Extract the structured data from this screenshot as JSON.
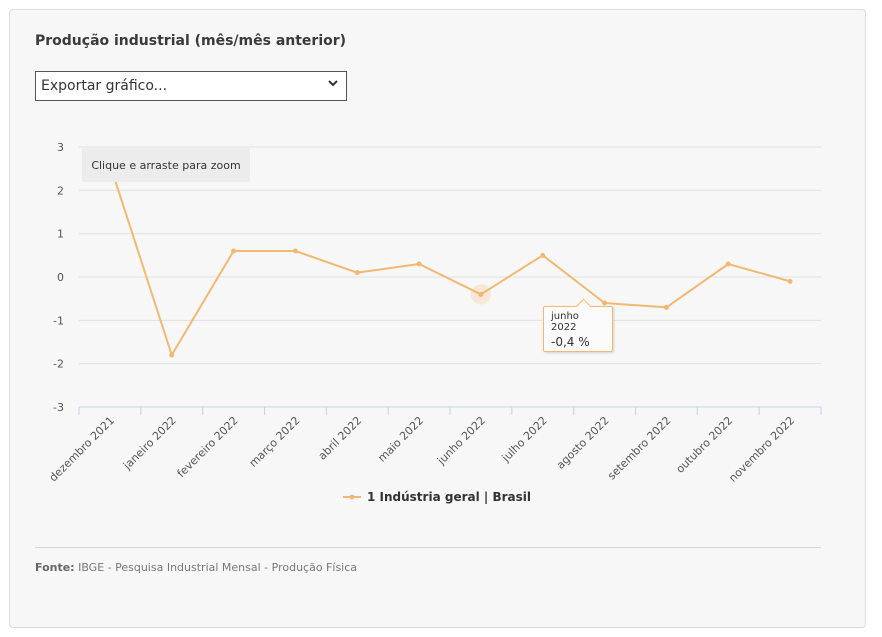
{
  "title": "Produção industrial (mês/mês anterior)",
  "export_select": {
    "selected": "Exportar gráfico...",
    "icon": "chevron-down-icon"
  },
  "zoom_hint": "Clique e arraste para zoom",
  "tooltip": {
    "date": "junho 2022",
    "value": "-0,4 %"
  },
  "legend": {
    "label": "1 Indústria geral | Brasil"
  },
  "source": {
    "label": "Fonte:",
    "text": "IBGE - Pesquisa Industrial Mensal - Produção Física"
  },
  "colors": {
    "series": "#f2b872",
    "grid": "#e2e2e2",
    "axis": "#c6d0e8",
    "card_bg": "#f7f7f7"
  },
  "chart_data": {
    "type": "line",
    "title": "Produção industrial (mês/mês anterior)",
    "xlabel": "",
    "ylabel": "",
    "categories": [
      "dezembro 2021",
      "janeiro 2022",
      "fevereiro 2022",
      "março 2022",
      "abril 2022",
      "maio 2022",
      "junho 2022",
      "julho 2022",
      "agosto 2022",
      "setembro 2022",
      "outubro 2022",
      "novembro 2022"
    ],
    "series": [
      {
        "name": "1 Indústria geral | Brasil",
        "values": [
          2.6,
          -1.8,
          0.6,
          0.6,
          0.1,
          0.3,
          -0.4,
          0.5,
          -0.6,
          -0.7,
          0.3,
          -0.1
        ]
      }
    ],
    "ylim": [
      -3,
      3
    ],
    "yticks": [
      "3",
      "2",
      "1",
      "0",
      "-1",
      "-2",
      "-3"
    ],
    "grid": true,
    "highlighted_point": "junho 2022",
    "legend_position": "bottom-center"
  }
}
